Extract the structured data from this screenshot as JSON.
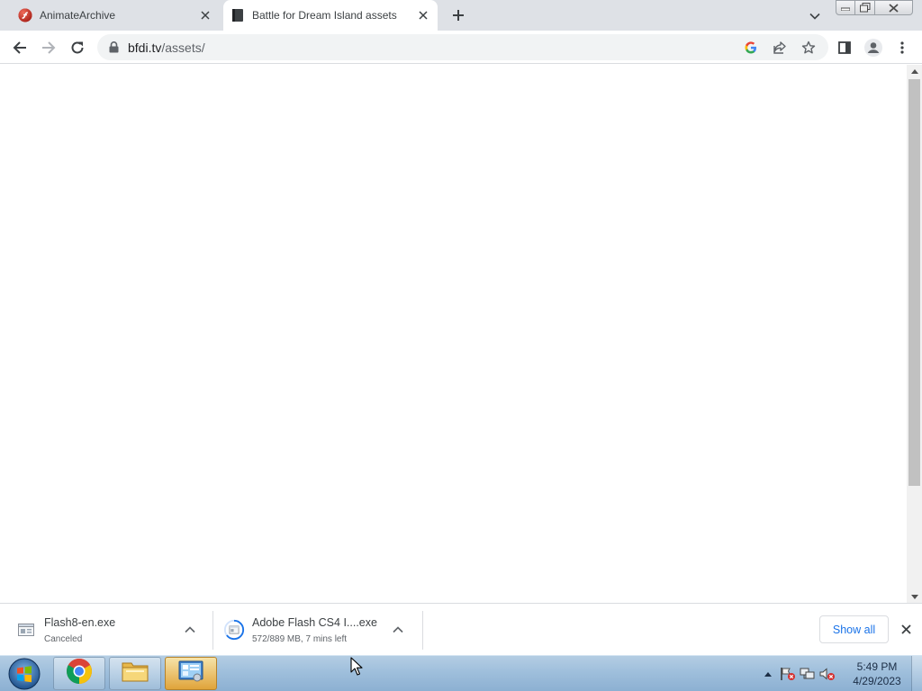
{
  "browser": {
    "tabs": [
      {
        "title": "AnimateArchive",
        "favicon": "flash-player-icon",
        "active": false
      },
      {
        "title": "Battle for Dream Island assets",
        "favicon": "page-icon",
        "active": true
      }
    ],
    "address": {
      "domain": "bfdi.tv",
      "path": "/assets/"
    },
    "colors": {
      "tabstrip": "#dee1e6",
      "accent": "#1a73e8"
    }
  },
  "downloads": {
    "items": [
      {
        "filename": "Flash8-en.exe",
        "status": "Canceled",
        "icon": "installer-file-icon"
      },
      {
        "filename": "Adobe Flash CS4 I....exe",
        "status": "572/889 MB, 7 mins left",
        "icon": "downloading-progress-icon",
        "progress": 0.643
      }
    ],
    "show_all_label": "Show all"
  },
  "taskbar": {
    "apps": [
      {
        "name": "chrome",
        "icon": "chrome-icon"
      },
      {
        "name": "explorer",
        "icon": "folder-icon"
      },
      {
        "name": "control-panel",
        "icon": "control-panel-icon",
        "active": true
      }
    ],
    "clock": {
      "time": "5:49 PM",
      "date": "4/29/2023"
    }
  }
}
